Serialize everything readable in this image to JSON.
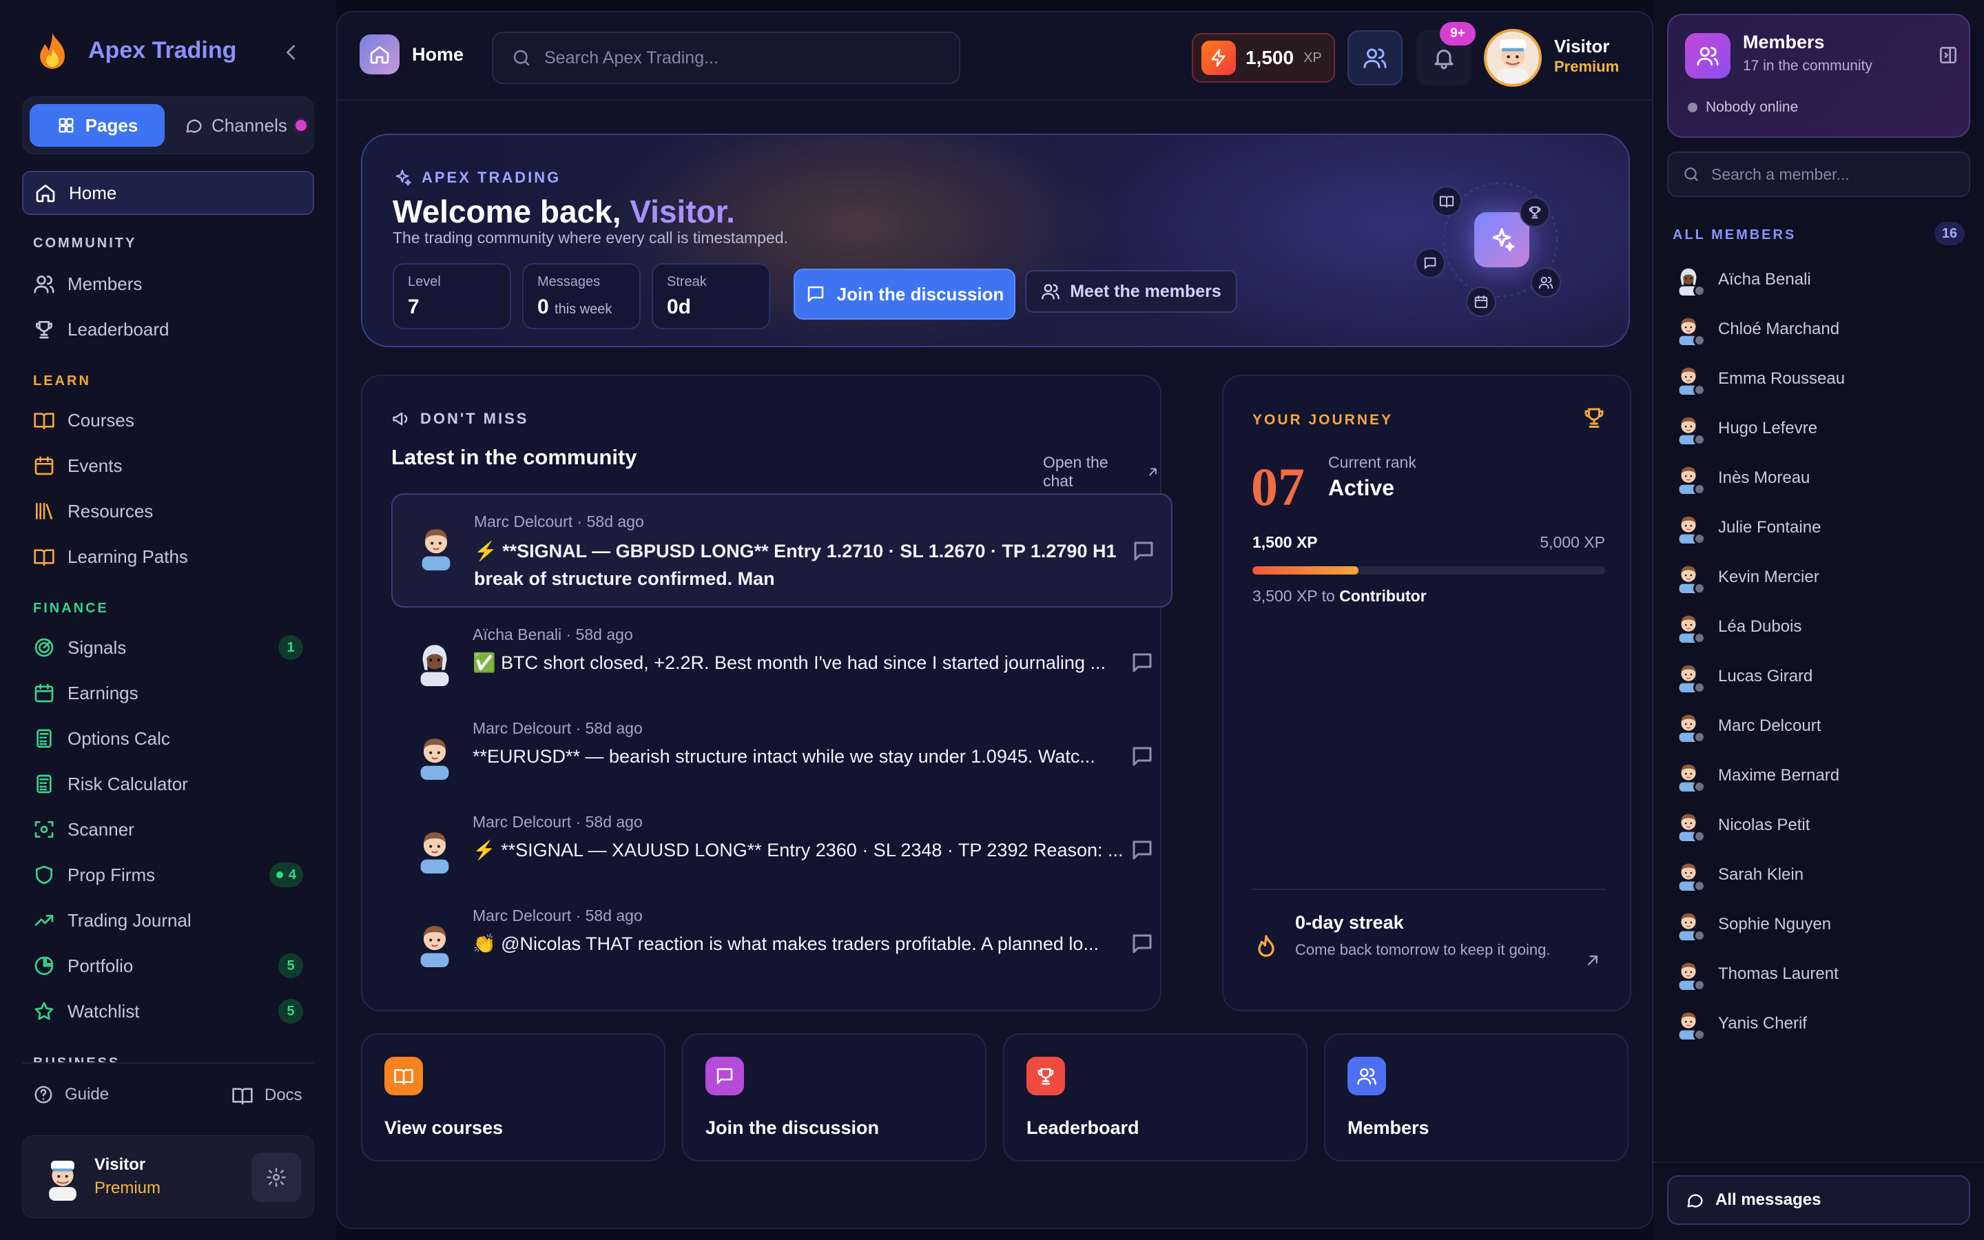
{
  "app": {
    "name": "Apex Trading"
  },
  "sidebar": {
    "tabs": {
      "pages": "Pages",
      "channels": "Channels"
    },
    "home": "Home",
    "sections": {
      "community": "COMMUNITY",
      "learn": "LEARN",
      "finance": "FINANCE",
      "business": "BUSINESS"
    },
    "community": [
      {
        "label": "Members",
        "icon": "users-icon"
      },
      {
        "label": "Leaderboard",
        "icon": "trophy-icon"
      }
    ],
    "learn": [
      {
        "label": "Courses",
        "icon": "book-icon"
      },
      {
        "label": "Events",
        "icon": "calendar-icon"
      },
      {
        "label": "Resources",
        "icon": "library-icon"
      },
      {
        "label": "Learning Paths",
        "icon": "book-open-icon"
      }
    ],
    "finance": [
      {
        "label": "Signals",
        "icon": "radar-icon",
        "badge": "1"
      },
      {
        "label": "Earnings",
        "icon": "calendar-icon"
      },
      {
        "label": "Options Calc",
        "icon": "calculator-icon"
      },
      {
        "label": "Risk Calculator",
        "icon": "calculator-icon"
      },
      {
        "label": "Scanner",
        "icon": "scan-icon"
      },
      {
        "label": "Prop Firms",
        "icon": "shield-icon",
        "badge": "4"
      },
      {
        "label": "Trading Journal",
        "icon": "trend-icon"
      },
      {
        "label": "Portfolio",
        "icon": "pie-icon",
        "badge": "5"
      },
      {
        "label": "Watchlist",
        "icon": "star-icon",
        "badge": "5"
      }
    ],
    "guide": "Guide",
    "docs": "Docs",
    "profile": {
      "name": "Visitor",
      "plan": "Premium"
    },
    "colors": {
      "accent": "#3e73f2",
      "section_community": "#c5c7dd",
      "section_learn": "#f5a73b",
      "section_finance": "#35d48d"
    }
  },
  "topbar": {
    "page": "Home",
    "search_placeholder": "Search Apex Trading...",
    "xp": "1,500",
    "xp_unit": "XP",
    "notifications": "9+",
    "user": {
      "name": "Visitor",
      "plan": "Premium"
    }
  },
  "hero": {
    "tag": "APEX TRADING",
    "title_prefix": "Welcome back, ",
    "title_name": "Visitor.",
    "subtitle": "The trading community where every call is timestamped.",
    "stats": [
      {
        "label": "Level",
        "value": "7",
        "unit": ""
      },
      {
        "label": "Messages",
        "value": "0",
        "unit": "this week"
      },
      {
        "label": "Streak",
        "value": "0d",
        "unit": ""
      }
    ],
    "cta_primary": "Join the discussion",
    "cta_secondary": "Meet the members"
  },
  "feed": {
    "tag": "DON'T MISS",
    "title": "Latest in the community",
    "open_chat": "Open the chat",
    "posts": [
      {
        "author": "Marc Delcourt",
        "time": "58d ago",
        "text": "⚡ **SIGNAL — GBPUSD LONG** Entry 1.2710 · SL 1.2670 · TP 1.2790 H1 break of structure confirmed. Man"
      },
      {
        "author": "Aïcha Benali",
        "time": "58d ago",
        "text": "✅ BTC short closed, +2.2R. Best month I've had since I started journaling ..."
      },
      {
        "author": "Marc Delcourt",
        "time": "58d ago",
        "text": "**EURUSD** — bearish structure intact while we stay under 1.0945. Watc..."
      },
      {
        "author": "Marc Delcourt",
        "time": "58d ago",
        "text": "⚡ **SIGNAL — XAUUSD LONG** Entry 2360 · SL 2348 · TP 2392 Reason: ..."
      },
      {
        "author": "Marc Delcourt",
        "time": "58d ago",
        "text": "👏 @Nicolas THAT reaction is what makes traders profitable. A planned lo..."
      }
    ]
  },
  "journey": {
    "tag": "YOUR JOURNEY",
    "rank_number": "07",
    "rank_label": "Current rank",
    "rank_value": "Active",
    "xp_current": "1,500 XP",
    "xp_goal": "5,000 XP",
    "progress": 0.3,
    "next_amount": "3,500 XP to",
    "next_rank": "Contributor",
    "streak_title": "0-day streak",
    "streak_desc": "Come back tomorrow to keep it going."
  },
  "quick_links": [
    {
      "label": "View courses",
      "icon": "book-icon",
      "color": "#f5831f"
    },
    {
      "label": "Join the discussion",
      "icon": "message-icon",
      "color": "#b54bd8"
    },
    {
      "label": "Leaderboard",
      "icon": "trophy-icon",
      "color": "#ef4b3f"
    },
    {
      "label": "Members",
      "icon": "users-icon",
      "color": "#4f6ff2"
    }
  ],
  "members_panel": {
    "title": "Members",
    "count_text": "17 in the community",
    "online": "Nobody online",
    "search_placeholder": "Search a member...",
    "all_label": "ALL MEMBERS",
    "all_count": "16",
    "members": [
      "Aïcha Benali",
      "Chloé Marchand",
      "Emma Rousseau",
      "Hugo Lefevre",
      "Inès Moreau",
      "Julie Fontaine",
      "Kevin Mercier",
      "Léa Dubois",
      "Lucas Girard",
      "Marc Delcourt",
      "Maxime Bernard",
      "Nicolas Petit",
      "Sarah Klein",
      "Sophie Nguyen",
      "Thomas Laurent",
      "Yanis Cherif"
    ],
    "all_messages": "All messages"
  }
}
